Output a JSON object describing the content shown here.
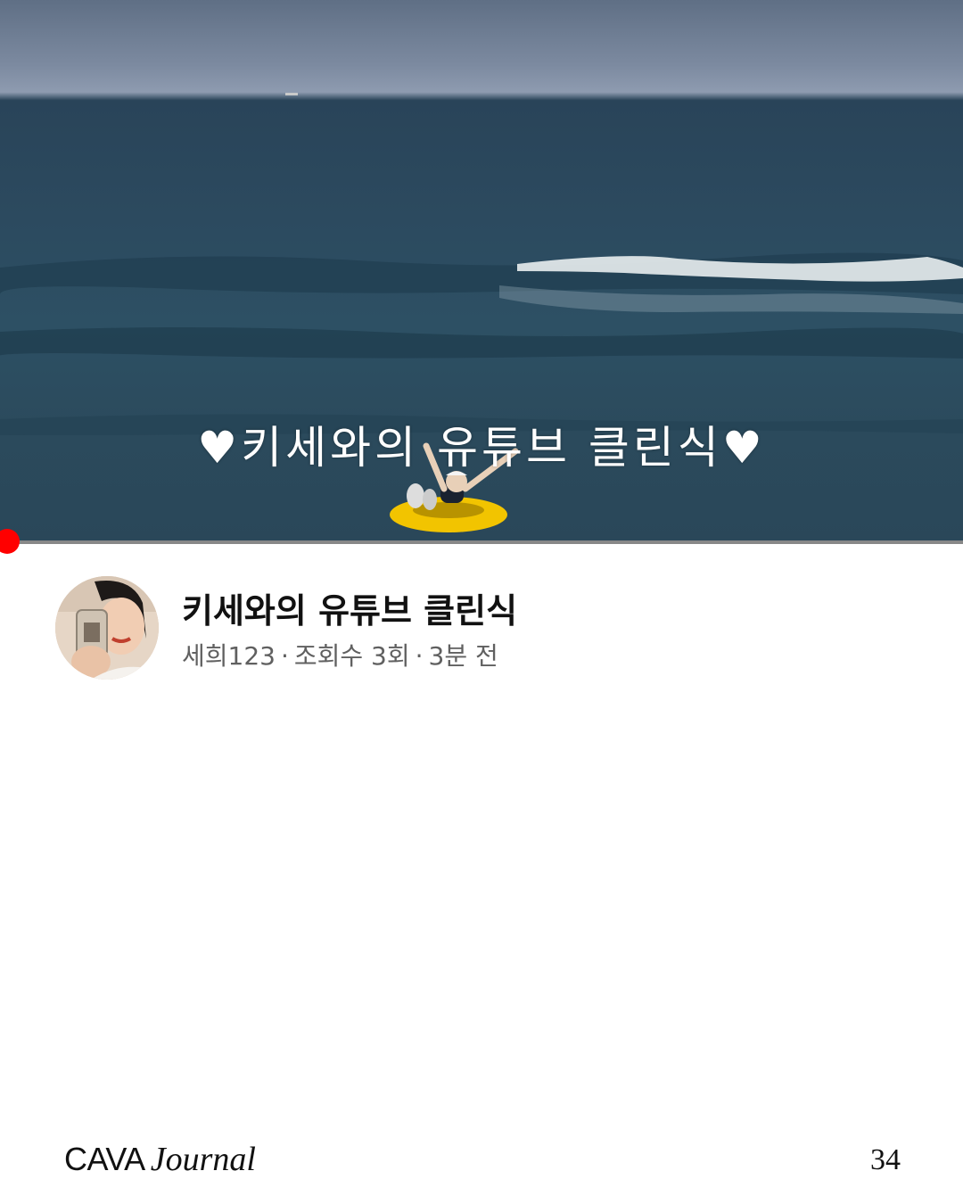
{
  "thumbnail": {
    "caption": "♥키세와의 유튜브 클린식♥",
    "progress_fraction": 0.01
  },
  "video": {
    "title": "키세와의 유튜브 클린식",
    "channel": "세희123",
    "views": "조회수 3회",
    "uploaded": "3분 전",
    "separator": "·"
  },
  "footer": {
    "brand_main": "CAVA",
    "brand_italic": "Journal",
    "page_number": "34"
  },
  "colors": {
    "progress": "#ff0000",
    "title": "#111111",
    "meta": "#606060"
  }
}
